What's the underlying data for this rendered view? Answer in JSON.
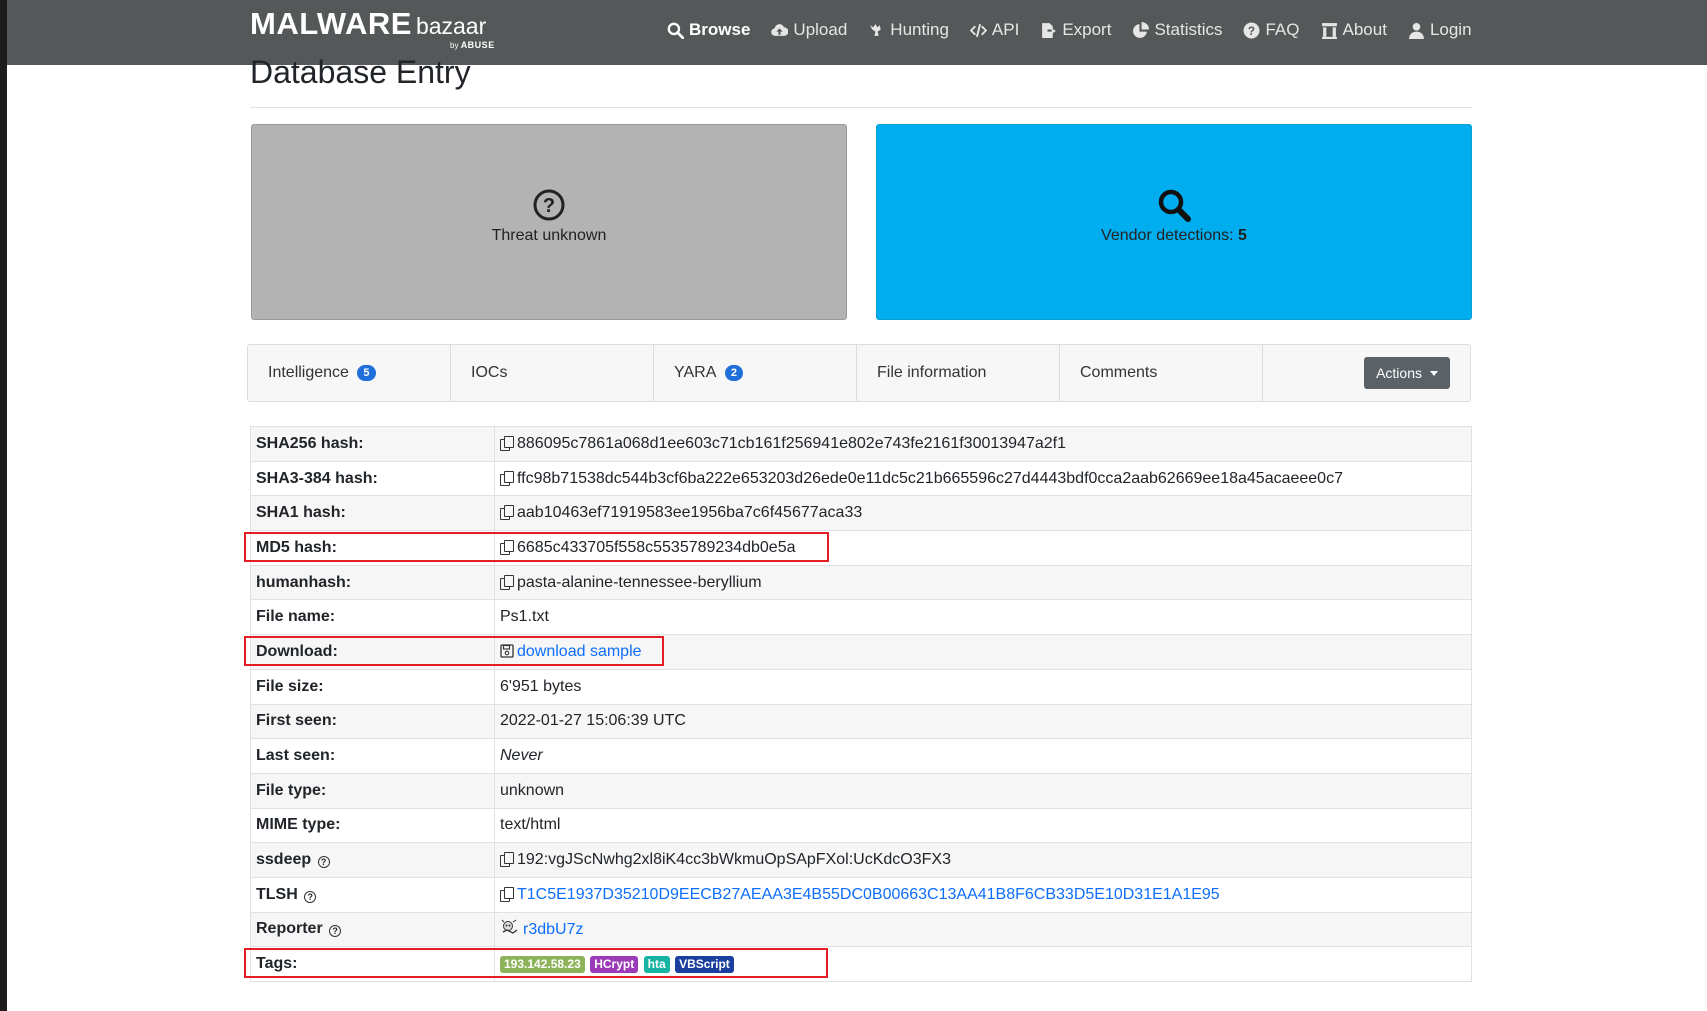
{
  "brand": {
    "main": "MALWARE",
    "sub": "bazaar",
    "by": "by",
    "org": "ABUSE"
  },
  "nav": [
    {
      "label": "Browse",
      "icon": "search-icon",
      "active": true
    },
    {
      "label": "Upload",
      "icon": "cloud-upload-icon"
    },
    {
      "label": "Hunting",
      "icon": "hunting-icon"
    },
    {
      "label": "API",
      "icon": "code-icon"
    },
    {
      "label": "Export",
      "icon": "export-icon"
    },
    {
      "label": "Statistics",
      "icon": "pie-chart-icon"
    },
    {
      "label": "FAQ",
      "icon": "question-circle-icon"
    },
    {
      "label": "About",
      "icon": "institution-icon"
    },
    {
      "label": "Login",
      "icon": "user-icon"
    }
  ],
  "page_title": "Database Entry",
  "cards": {
    "threat": {
      "text": "Threat unknown",
      "icon": "question-circle-icon",
      "color": "#b3b3b3"
    },
    "vendor": {
      "text": "Vendor detections: ",
      "count": "5",
      "icon": "search-icon",
      "color": "#00aeef"
    }
  },
  "tabs": [
    {
      "label": "Intelligence",
      "badge": "5"
    },
    {
      "label": "IOCs"
    },
    {
      "label": "YARA",
      "badge": "2"
    },
    {
      "label": "File information"
    },
    {
      "label": "Comments"
    }
  ],
  "actions_label": "Actions",
  "rows": {
    "sha256": {
      "key": "SHA256 hash:",
      "value": "886095c7861a068d1ee603c71cb161f256941e802e743fe2161f30013947a2f1"
    },
    "sha3": {
      "key": "SHA3-384 hash:",
      "value": "ffc98b71538dc544b3cf6ba222e653203d26ede0e11dc5c21b665596c27d4443bdf0cca2aab62669ee18a45acaeee0c7"
    },
    "sha1": {
      "key": "SHA1 hash:",
      "value": "aab10463ef71919583ee1956ba7c6f45677aca33"
    },
    "md5": {
      "key": "MD5 hash:",
      "value": "6685c433705f558c5535789234db0e5a"
    },
    "humanhash": {
      "key": "humanhash:",
      "value": "pasta-alanine-tennessee-beryllium"
    },
    "filename": {
      "key": "File name:",
      "value": "Ps1.txt"
    },
    "download": {
      "key": "Download:",
      "value": "download sample"
    },
    "filesize": {
      "key": "File size:",
      "value": "6'951 bytes"
    },
    "firstseen": {
      "key": "First seen:",
      "value": "2022-01-27 15:06:39 UTC"
    },
    "lastseen": {
      "key": "Last seen:",
      "value": "Never"
    },
    "filetype": {
      "key": "File type:",
      "value": "unknown"
    },
    "mimetype": {
      "key": "MIME type:",
      "value": "text/html"
    },
    "ssdeep": {
      "key": "ssdeep",
      "value": "192:vgJScNwhg2xl8iK4cc3bWkmuOpSApFXol:UcKdcO3FX3"
    },
    "tlsh": {
      "key": "TLSH",
      "value": "T1C5E1937D35210D9EECB27AEAA3E4B55DC0B00663C13AA41B8F6CB33D5E10D31E1A1E95"
    },
    "reporter": {
      "key": "Reporter",
      "value": "r3dbU7z"
    },
    "tags": {
      "key": "Tags:"
    }
  },
  "tags": [
    {
      "label": "193.142.58.23",
      "color": "#8cb35a"
    },
    {
      "label": "HCrypt",
      "color": "#9b3bb8"
    },
    {
      "label": "hta",
      "color": "#17b3a3"
    },
    {
      "label": "VBScript",
      "color": "#1b3f9e"
    }
  ]
}
